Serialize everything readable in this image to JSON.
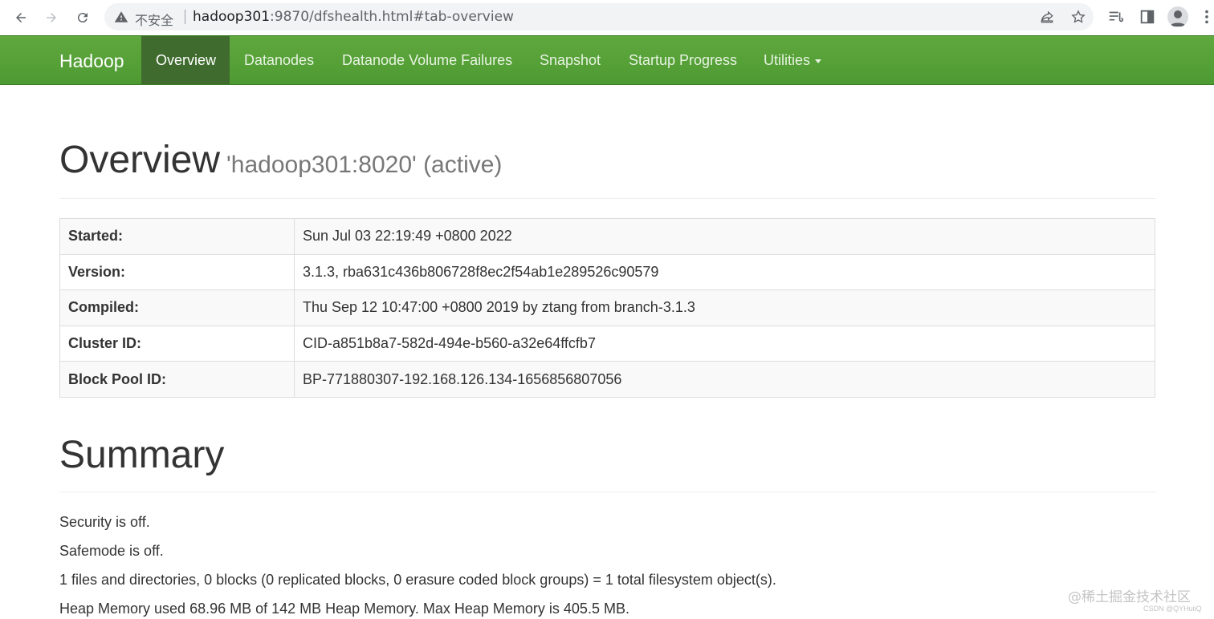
{
  "browser": {
    "insecure_label": "不安全",
    "url_host": "hadoop301",
    "url_rest": ":9870/dfshealth.html#tab-overview"
  },
  "navbar": {
    "brand": "Hadoop",
    "items": [
      {
        "label": "Overview",
        "active": true
      },
      {
        "label": "Datanodes"
      },
      {
        "label": "Datanode Volume Failures"
      },
      {
        "label": "Snapshot"
      },
      {
        "label": "Startup Progress"
      },
      {
        "label": "Utilities"
      }
    ],
    "active_bg": "#3f6b2e",
    "bar_color": "#5fa83e"
  },
  "overview": {
    "title": "Overview",
    "subtitle": "'hadoop301:8020' (active)",
    "rows": [
      {
        "label": "Started:",
        "value": "Sun Jul 03 22:19:49 +0800 2022"
      },
      {
        "label": "Version:",
        "value": "3.1.3, rba631c436b806728f8ec2f54ab1e289526c90579"
      },
      {
        "label": "Compiled:",
        "value": "Thu Sep 12 10:47:00 +0800 2019 by ztang from branch-3.1.3"
      },
      {
        "label": "Cluster ID:",
        "value": "CID-a851b8a7-582d-494e-b560-a32e64ffcfb7"
      },
      {
        "label": "Block Pool ID:",
        "value": "BP-771880307-192.168.126.134-1656856807056"
      }
    ]
  },
  "summary": {
    "title": "Summary",
    "lines": [
      "Security is off.",
      "Safemode is off.",
      "1 files and directories, 0 blocks (0 replicated blocks, 0 erasure coded block groups) = 1 total filesystem object(s).",
      "Heap Memory used 68.96 MB of 142 MB Heap Memory. Max Heap Memory is 405.5 MB."
    ]
  },
  "watermark": {
    "main": "@稀土掘金技术社区",
    "small": "CSDN @QYHuiiQ"
  }
}
